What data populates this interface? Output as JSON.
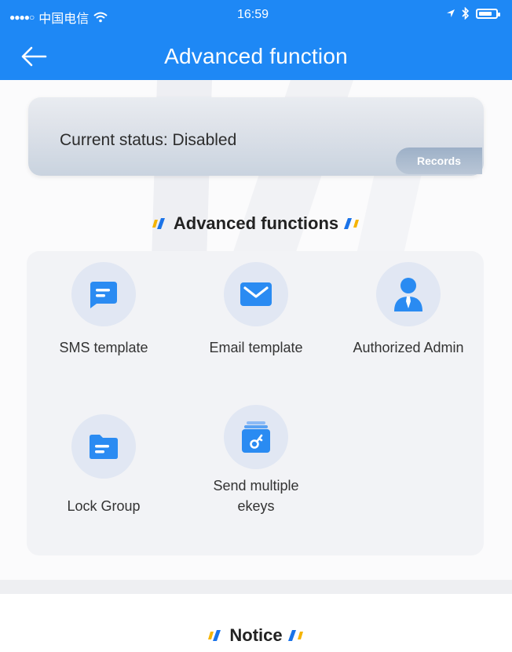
{
  "status_bar": {
    "signal_dots": "●●●●○",
    "carrier": "中国电信",
    "time": "16:59"
  },
  "nav": {
    "title": "Advanced function"
  },
  "status_card": {
    "status_text": "Current status: Disabled",
    "records_label": "Records"
  },
  "advanced_section": {
    "heading": "Advanced functions",
    "items": [
      {
        "label": "SMS template",
        "icon": "sms-icon"
      },
      {
        "label": "Email template",
        "icon": "email-icon"
      },
      {
        "label": "Authorized Admin",
        "icon": "admin-icon"
      },
      {
        "label": "Lock Group",
        "icon": "folder-icon"
      },
      {
        "label": "Send multiple ekeys",
        "icon": "ekeys-icon"
      }
    ]
  },
  "notice_section": {
    "heading": "Notice"
  },
  "colors": {
    "primary": "#1e88f5",
    "icon_blue": "#2a8bf2",
    "card_bg": "#f2f3f6",
    "heading_mark_blue": "#1a73e8",
    "heading_mark_yellow": "#f5b400"
  }
}
